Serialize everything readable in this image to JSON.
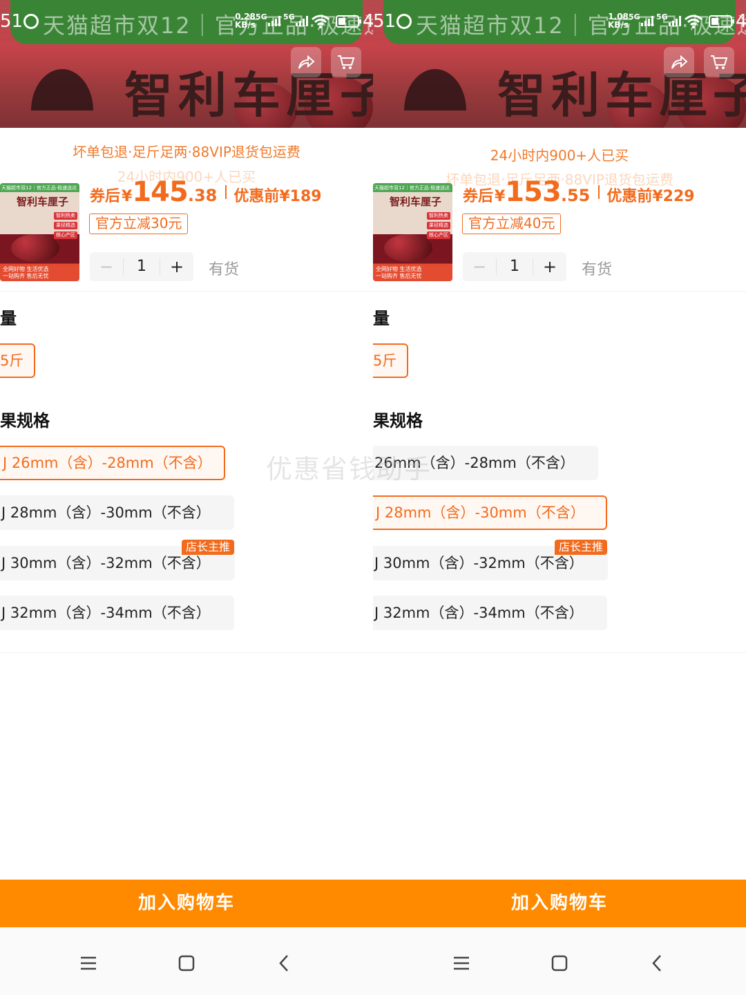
{
  "watermark": "优惠省钱助手",
  "colors": {
    "accent": "#f26b1d",
    "cta": "#ff8a00"
  },
  "left": {
    "status": {
      "time": "51",
      "speed_value": "0.28",
      "speed_unit": "KB/s",
      "sig1": "5G",
      "sig2": "5G",
      "battery": "4"
    },
    "hero": {
      "banner_text": "天猫超市双12｜官方正品·极速送达",
      "title": "智利车厘子"
    },
    "promo_line1": "坏单包退·足斤足两·88VIP退货包运费",
    "promo_line2": "24小时内900+人已买",
    "thumb": {
      "top": "天猫超市双12｜官方正品·极速送达",
      "title": "智利车厘子",
      "tags": [
        "智利热卖",
        "果径精选",
        "核心产区"
      ],
      "bottom1": "全网好物 生活优选",
      "bottom2": "一站购齐 售后无忧"
    },
    "price": {
      "label": "券后",
      "currency": "¥",
      "integer": "145",
      "decimal": ".38",
      "orig_label": "优惠前",
      "orig": "¥189"
    },
    "coupon": "官方立减30元",
    "stepper": {
      "minus": "−",
      "qty": "1",
      "plus": "+"
    },
    "stock": "有货",
    "weight_title": "量",
    "weight_option": "5斤",
    "spec_title": "果规格",
    "specs": [
      "J 26mm（含）-28mm（不含）",
      "J 28mm（含）-30mm（不含）",
      "J 30mm（含）-32mm（不含）",
      "J 32mm（含）-34mm（不含）"
    ],
    "recommend_tag": "店长主推",
    "cta": "加入购物车"
  },
  "right": {
    "status": {
      "time": "51",
      "speed_value": "1.08",
      "speed_unit": "KB/s",
      "sig1": "5G",
      "sig2": "5G",
      "battery": "4"
    },
    "hero": {
      "banner_text": "天猫超市双12｜官方正品·极速送达",
      "title": "智利车厘子"
    },
    "promo_line1": "24小时内900+人已买",
    "promo_line2": "坏单包退·足斤足两·88VIP退货包运费",
    "thumb": {
      "top": "天猫超市双12｜官方正品·极速送达",
      "title": "智利车厘子",
      "tags": [
        "智利热卖",
        "果径精选",
        "核心产区"
      ],
      "bottom1": "全网好物 生活优选",
      "bottom2": "一站购齐 售后无忧"
    },
    "price": {
      "label": "券后",
      "currency": "¥",
      "integer": "153",
      "decimal": ".55",
      "orig_label": "优惠前",
      "orig": "¥229"
    },
    "coupon": "官方立减40元",
    "stepper": {
      "minus": "−",
      "qty": "1",
      "plus": "+"
    },
    "stock": "有货",
    "weight_title": "量",
    "weight_option": "5斤",
    "spec_title": "果规格",
    "specs": [
      "26mm（含）-28mm（不含）",
      "J 28mm（含）-30mm（不含）",
      "J 30mm（含）-32mm（不含）",
      "J 32mm（含）-34mm（不含）"
    ],
    "recommend_tag": "店长主推",
    "cta": "加入购物车"
  }
}
